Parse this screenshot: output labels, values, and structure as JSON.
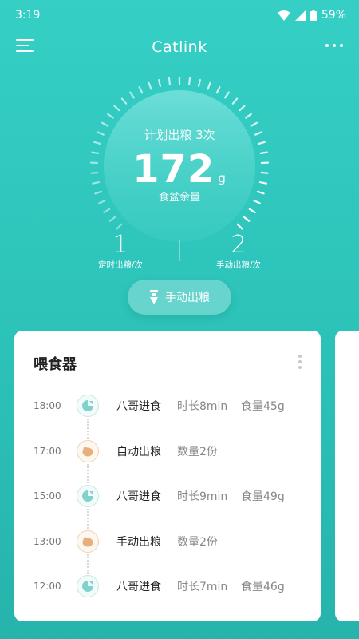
{
  "status_bar": {
    "time": "3:19",
    "battery": "59%"
  },
  "app_bar": {
    "title": "Catlink"
  },
  "gauge": {
    "plan_text": "计划出粮 3次",
    "remaining_value": "172",
    "remaining_unit": "g",
    "remaining_label": "食盆余量"
  },
  "stats": {
    "scheduled_count": "1",
    "scheduled_label": "定时出粮/次",
    "manual_count": "2",
    "manual_label": "手动出粮/次"
  },
  "manual_button": {
    "label": "手动出粮",
    "icon": "food-drop-icon"
  },
  "feeder_card": {
    "title": "喂食器",
    "entries": [
      {
        "time": "18:00",
        "icon": "cat-icon",
        "event": "八哥进食",
        "detail1": "时长8min",
        "detail2": "食量45g"
      },
      {
        "time": "17:00",
        "icon": "food-icon",
        "event": "自动出粮",
        "detail1": "数量2份",
        "detail2": ""
      },
      {
        "time": "15:00",
        "icon": "cat-icon",
        "event": "八哥进食",
        "detail1": "时长9min",
        "detail2": "食量49g"
      },
      {
        "time": "13:00",
        "icon": "food-icon",
        "event": "手动出粮",
        "detail1": "数量2份",
        "detail2": ""
      },
      {
        "time": "12:00",
        "icon": "cat-icon",
        "event": "八哥进食",
        "detail1": "时长7min",
        "detail2": "食量46g"
      }
    ]
  },
  "colors": {
    "background": "#35cfc6",
    "cat_icon": "#7fd3cc",
    "food_icon": "#e7b07a"
  }
}
